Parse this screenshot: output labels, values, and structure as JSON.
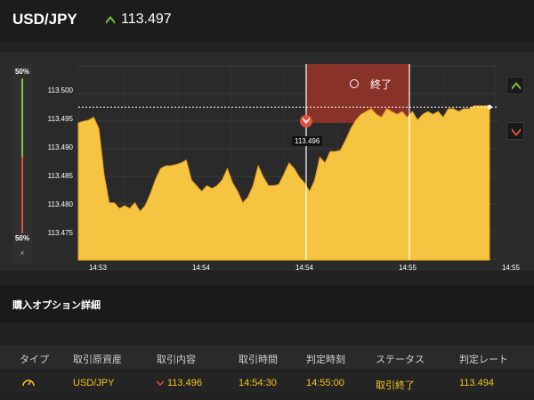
{
  "header": {
    "pair": "USD/JPY",
    "price": "113.497",
    "price_direction_icon": "up-chevron-icon",
    "up_color": "#7fc242"
  },
  "sentiment": {
    "top_pct": "50%",
    "bottom_pct": "50%",
    "close": "×",
    "up_color": "#7fc242",
    "down_color": "#e0533a"
  },
  "trade_panel": {
    "status_label": "終了",
    "status_icon": "history-icon",
    "entry_rate_label": "113.496",
    "up_button_icon": "up-chevron-icon",
    "down_button_icon": "down-chevron-icon"
  },
  "chart_data": {
    "type": "area",
    "y_ticks": [
      "113.500",
      "113.495",
      "113.490",
      "113.485",
      "113.480",
      "113.475"
    ],
    "x_ticks": [
      "14:53",
      "14:54",
      "14:54",
      "14:55",
      "14:55"
    ],
    "current_rate": 113.497,
    "entry_rate": 113.496,
    "fill_color": "#f5c542",
    "highlight_color": "#8e3328",
    "values": [
      113.4942,
      113.4945,
      113.4947,
      113.4952,
      113.4932,
      113.4852,
      113.4802,
      113.4802,
      113.4792,
      113.4797,
      113.4792,
      113.4802,
      113.4787,
      113.4797,
      113.4817,
      113.4842,
      113.4862,
      113.4867,
      113.4867,
      113.4869,
      113.4872,
      113.4877,
      113.4842,
      113.4832,
      113.4822,
      113.4832,
      113.4827,
      113.4832,
      113.4842,
      113.4862,
      113.4837,
      113.4822,
      113.4802,
      113.4812,
      113.4832,
      113.4867,
      113.4847,
      113.4832,
      113.4832,
      113.4834,
      113.4852,
      113.4872,
      113.4862,
      113.4847,
      113.4837,
      113.4822,
      113.4842,
      113.4882,
      113.4872,
      113.4892,
      113.4892,
      113.4894,
      113.4912,
      113.4932,
      113.4947,
      113.4957,
      113.4962,
      113.4967,
      113.4957,
      113.4952,
      113.4967,
      113.4962,
      113.4957,
      113.4962,
      113.4952,
      113.4962,
      113.4947,
      113.4957,
      113.4962,
      113.4957,
      113.4962,
      113.4952,
      113.4967,
      113.4967,
      113.4962,
      113.4967,
      113.4967,
      113.4972,
      113.4972,
      113.4972,
      113.4972
    ]
  },
  "details": {
    "title": "購入オプション詳細",
    "columns": [
      "タイプ",
      "取引原資産",
      "取引内容",
      "取引時間",
      "判定時刻",
      "ステータス",
      "判定レート"
    ],
    "row": {
      "type_icon": "gauge-icon",
      "asset": "USD/JPY",
      "direction_icon": "down-chevron-icon",
      "content": "113.496",
      "trade_time": "14:54:30",
      "judge_time": "14:55:00",
      "status": "取引終了",
      "judge_rate": "113.494"
    },
    "accent_color": "#f5c518"
  }
}
